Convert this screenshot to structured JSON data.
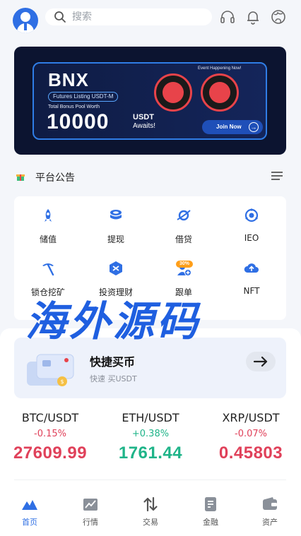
{
  "header": {
    "search_placeholder": "搜索",
    "avatar_icon": "user-avatar-icon",
    "actions": [
      "headset-icon",
      "bell-icon",
      "globe-icon"
    ]
  },
  "banner": {
    "brand": "BNX",
    "listing": "Futures Listing USDT-M",
    "pool_label": "Total Bonus Pool Worth",
    "amount": "10000",
    "unit": "USDT",
    "awaits": "Awaits!",
    "event": "Event Happening Now!",
    "join": "Join Now"
  },
  "notice": {
    "title": "平台公告"
  },
  "grid": {
    "items": [
      {
        "label": "储值",
        "icon": "rocket-icon"
      },
      {
        "label": "提现",
        "icon": "coins-stack-icon"
      },
      {
        "label": "借贷",
        "icon": "planet-icon"
      },
      {
        "label": "IEO",
        "icon": "target-icon"
      },
      {
        "label": "锁仓挖矿",
        "icon": "pickaxe-icon"
      },
      {
        "label": "投资理财",
        "icon": "hexagon-icon"
      },
      {
        "label": "跟单",
        "icon": "add-user-icon"
      },
      {
        "label": "NFT",
        "icon": "cloud-upload-icon"
      }
    ],
    "follow_badge": "30%"
  },
  "watermark": "海外源码",
  "quick_buy": {
    "title": "快捷买币",
    "subtitle": "快速 买USDT"
  },
  "tickers": [
    {
      "pair": "BTC/USDT",
      "change": "-0.15%",
      "price": "27609.99",
      "direction": "down"
    },
    {
      "pair": "ETH/USDT",
      "change": "+0.38%",
      "price": "1761.44",
      "direction": "up"
    },
    {
      "pair": "XRP/USDT",
      "change": "-0.07%",
      "price": "0.45803",
      "direction": "down"
    }
  ],
  "tabbar": {
    "items": [
      {
        "label": "首页",
        "icon": "home-mountain-icon",
        "active": true
      },
      {
        "label": "行情",
        "icon": "chart-icon",
        "active": false
      },
      {
        "label": "交易",
        "icon": "swap-arrows-icon",
        "active": false
      },
      {
        "label": "金融",
        "icon": "document-icon",
        "active": false
      },
      {
        "label": "资产",
        "icon": "wallet-icon",
        "active": false
      }
    ]
  },
  "colors": {
    "accent": "#2f6fe4",
    "down": "#e0415a",
    "up": "#1fb489"
  }
}
